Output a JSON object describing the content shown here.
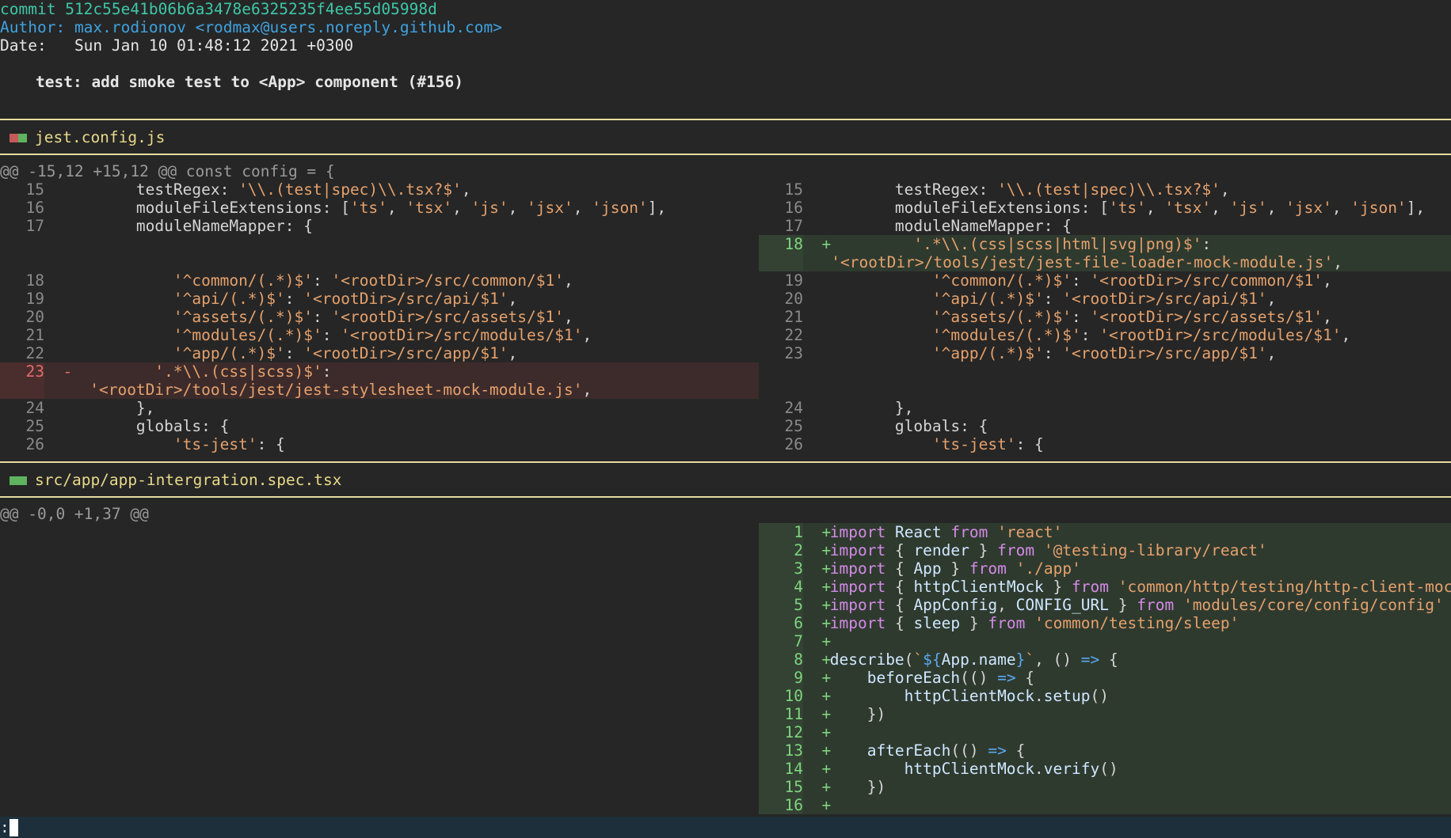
{
  "commit": {
    "label": "commit",
    "hash": "512c55e41b06b6a3478e6325235f4ee55d05998d",
    "author_label": "Author:",
    "author_name": "max.rodionov",
    "author_email": "<rodmax@users.noreply.github.com>",
    "date_label": "Date:",
    "date_value": "Sun Jan 10 01:48:12 2021 +0300",
    "message": "test: add smoke test to <App> component (#156)"
  },
  "files": [
    {
      "name": "jest.config.js",
      "status": "modified",
      "hunk": "@@ -15,12 +15,12 @@ const config = {"
    },
    {
      "name": "src/app/app-intergration.spec.tsx",
      "status": "added",
      "hunk": "@@ -0,0 +1,37 @@"
    }
  ],
  "status_prompt": ":",
  "colors": {
    "background": "#262626",
    "commit_hash": "#3fc7a8",
    "author": "#3fa2e0",
    "file_header": "#e8d98a",
    "separator": "#e6dca0",
    "deleted_bg": "#3d2b2b",
    "added_bg": "#2f3a2f",
    "string": "#e5a16c",
    "keyword": "#d38be6"
  }
}
